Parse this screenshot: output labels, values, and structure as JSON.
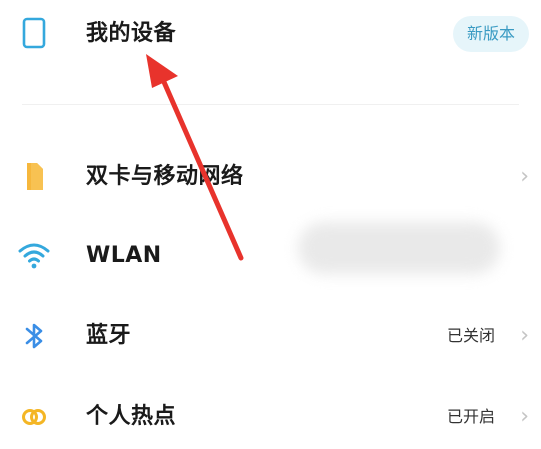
{
  "colors": {
    "accent": "#3a9bc3",
    "badge_bg": "#e6f5fa",
    "sim_icon": "#f6b73c",
    "wlan_icon": "#34a8dd",
    "bluetooth_icon": "#3a8ee6",
    "hotspot_icon": "#f4b625",
    "annotation_arrow": "#e8332c"
  },
  "device": {
    "label": "我的设备",
    "badge": "新版本",
    "icon": "phone-outline-icon"
  },
  "items": [
    {
      "label": "双卡与移动网络",
      "status": "",
      "icon": "sim-card-icon"
    },
    {
      "label": "WLAN",
      "status": "",
      "icon": "wifi-icon"
    },
    {
      "label": "蓝牙",
      "status": "已关闭",
      "icon": "bluetooth-icon"
    },
    {
      "label": "个人热点",
      "status": "已开启",
      "icon": "hotspot-icon"
    }
  ]
}
